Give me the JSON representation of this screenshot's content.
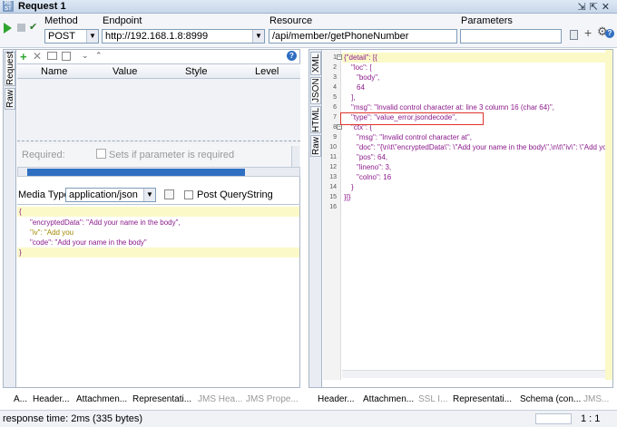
{
  "window": {
    "title": "Request 1",
    "icon_text": "RE ST"
  },
  "toolbar": {
    "method_label": "Method",
    "method_value": "POST",
    "endpoint_label": "Endpoint",
    "endpoint_value": "http://192.168.1.8:8999",
    "resource_label": "Resource",
    "resource_value": "/api/member/getPhoneNumber",
    "parameters_label": "Parameters",
    "parameters_value": ""
  },
  "left": {
    "vtabs": [
      "Request",
      "Raw"
    ],
    "grid_headers": [
      "Name",
      "Value",
      "Style",
      "Level"
    ],
    "required_label": "Required:",
    "sets_if_required": "Sets if parameter is required",
    "media_type_label": "Media Type",
    "media_type_value": "application/json",
    "post_querystring": "Post QueryString",
    "body_lines": [
      "{",
      "\"encryptedData\": \"Add your name in the body\",",
      "\"iv\": \"Add you",
      "\"code\": \"Add your name in the body\"",
      "}"
    ],
    "bottom_tabs": [
      "A...",
      "Header...",
      "Attachmen...",
      "Representati...",
      "JMS Hea...",
      "JMS Prope..."
    ]
  },
  "right": {
    "vtabs": [
      "XML",
      "JSON",
      "HTML",
      "Raw"
    ],
    "line_numbers": [
      "1",
      "2",
      "3",
      "4",
      "5",
      "6",
      "7",
      "8",
      "9",
      "10",
      "11",
      "12",
      "13",
      "14",
      "15",
      "16"
    ],
    "json_lines": [
      "{\"detail\": [{",
      "\"loc\":   [",
      "\"body\",",
      "64",
      "],",
      "\"msg\": \"Invalid control character at: line 3 column 16 (char 64)\",",
      "\"type\": \"value_error.jsondecode\",",
      "\"ctx\":   {",
      "\"msg\": \"Invalid control character at\",",
      "\"doc\": \"{\\n\\t\\\"encryptedData\\\": \\\"Add your name in the body\\\",\\n\\t\\\"iv\\\": \\\"Add you",
      "\"pos\": 64,",
      "\"lineno\": 3,",
      "\"colno\": 16",
      "}",
      "}]}"
    ],
    "bottom_tabs": [
      "Header...",
      "Attachmen...",
      "SSL I...",
      "Representati...",
      "Schema (con...",
      "JMS..."
    ]
  },
  "status": {
    "text": "response time: 2ms (335 bytes)",
    "position": "1 : 1"
  },
  "colors": {
    "highlight": "#fbf9c8",
    "json_text": "#8b1a8b",
    "box": "#e0342b",
    "accent": "#2f6fc2"
  }
}
